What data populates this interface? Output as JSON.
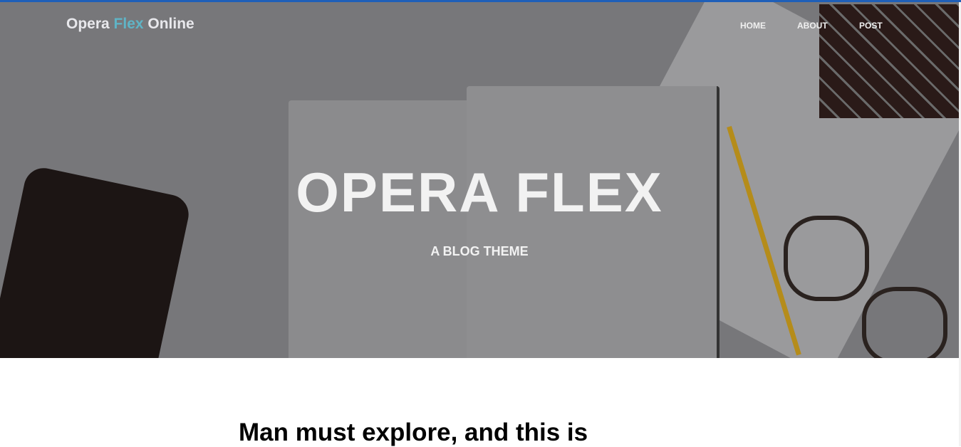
{
  "brand": {
    "part1": "Opera ",
    "part2": "Flex",
    "part3": " Online",
    "accent_color": "#5fb4c6"
  },
  "nav": [
    {
      "label": "HOME"
    },
    {
      "label": "ABOUT"
    },
    {
      "label": "POST"
    }
  ],
  "hero": {
    "title": "OPERA FLEX",
    "subtitle": "A BLOG THEME"
  },
  "post": {
    "heading": "Man must explore, and this is"
  }
}
